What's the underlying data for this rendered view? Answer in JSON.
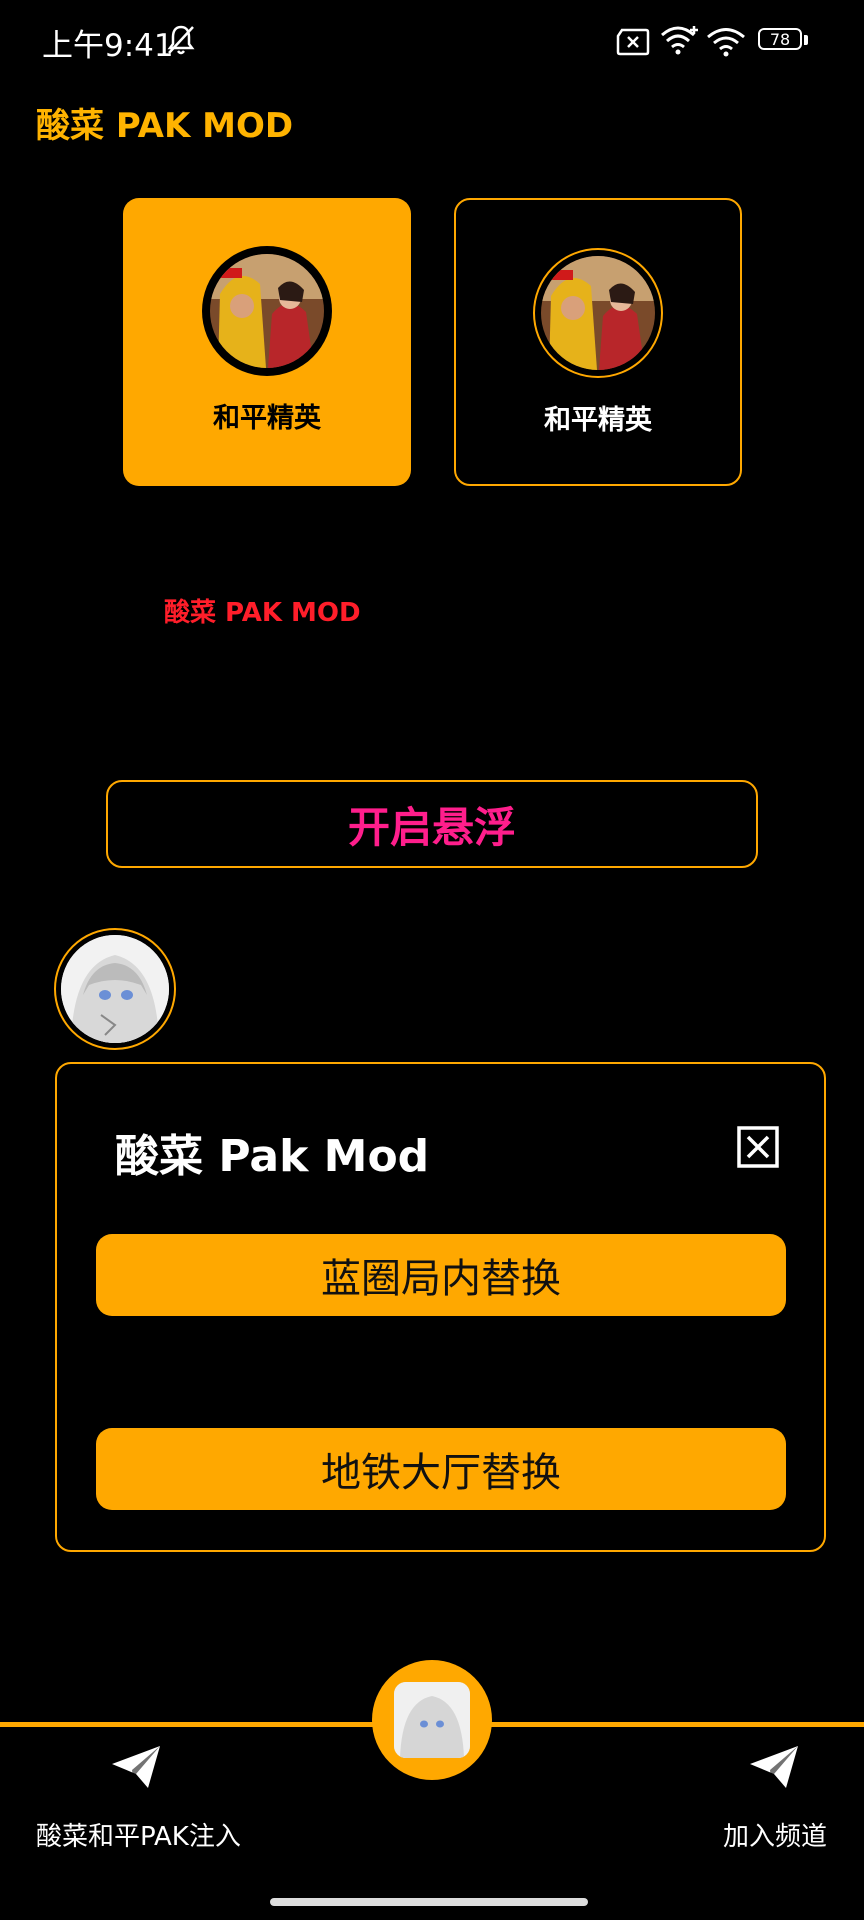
{
  "status_bar": {
    "time": "上午9:41",
    "battery": "78",
    "icons": [
      "bell-off-icon",
      "sim-x-icon",
      "wifi-plus-icon",
      "wifi-icon",
      "battery-icon"
    ]
  },
  "app": {
    "title": "酸菜 PAK MOD"
  },
  "games": [
    {
      "label": "和平精英",
      "selected": true
    },
    {
      "label": "和平精英",
      "selected": false
    }
  ],
  "red_title": "酸菜 PAK MOD",
  "float_button": {
    "label": "开启悬浮"
  },
  "panel": {
    "title": "酸菜 Pak Mod",
    "buttons": [
      {
        "label": "蓝圈局内替换"
      },
      {
        "label": "地铁大厅替换"
      }
    ]
  },
  "bottom_nav": {
    "left_label": "酸菜和平PAK注入",
    "right_label": "加入频道",
    "left_icon": "send-icon",
    "right_icon": "send-icon"
  },
  "colors": {
    "accent": "#ffa800",
    "title_yellow": "#ffb300",
    "red": "#ff1e2a",
    "pink": "#ff1e8c",
    "background": "#000000"
  }
}
